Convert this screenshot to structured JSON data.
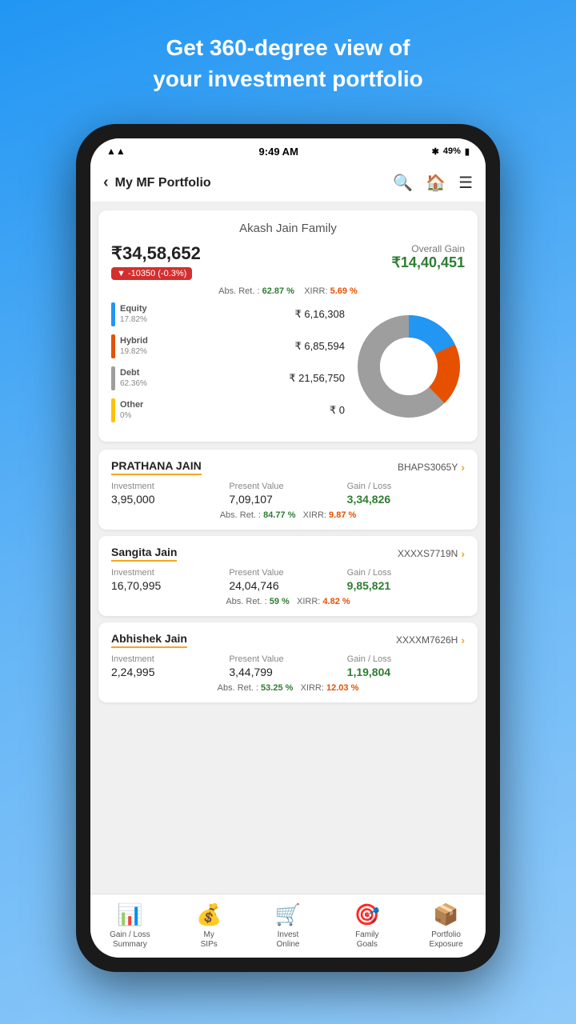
{
  "header_text": {
    "line1": "Get 360-degree view of",
    "line2": "your investment portfolio"
  },
  "status_bar": {
    "time": "9:49 AM",
    "battery": "49%",
    "bluetooth": "49%"
  },
  "page_title": "My MF Portfolio",
  "family": {
    "name": "Akash Jain Family",
    "total_value": "₹34,58,652",
    "change": "▼ -10350  (-0.3%)",
    "overall_gain_label": "Overall Gain",
    "overall_gain": "₹14,40,451",
    "abs_ret_label": "Abs. Ret. :",
    "abs_ret_value": "62.87 %",
    "xirr_label": "XIRR:",
    "xirr_value": "5.69 %"
  },
  "chart_legend": [
    {
      "name": "Equity",
      "pct": "17.82%",
      "value": "₹ 6,16,308",
      "color": "#2196F3"
    },
    {
      "name": "Hybrid",
      "pct": "19.82%",
      "value": "₹ 6,85,594",
      "color": "#e65100"
    },
    {
      "name": "Debt",
      "pct": "62.36%",
      "value": "₹ 21,56,750",
      "color": "#9e9e9e"
    },
    {
      "name": "Other",
      "pct": "0%",
      "value": "₹ 0",
      "color": "#FFC107"
    }
  ],
  "members": [
    {
      "name": "PRATHANA JAIN",
      "id": "BHAPS3065Y",
      "investment": "3,95,000",
      "present_value": "7,09,107",
      "gain_loss": "3,34,826",
      "abs_ret": "84.77 %",
      "xirr": "9.87 %"
    },
    {
      "name": "Sangita Jain",
      "id": "XXXXS7719N",
      "investment": "16,70,995",
      "present_value": "24,04,746",
      "gain_loss": "9,85,821",
      "abs_ret": "59 %",
      "xirr": "4.82 %"
    },
    {
      "name": "Abhishek Jain",
      "id": "XXXXM7626H",
      "investment": "2,24,995",
      "present_value": "3,44,799",
      "gain_loss": "1,19,804",
      "abs_ret": "53.25 %",
      "xirr": "12.03 %"
    }
  ],
  "bottom_nav": [
    {
      "id": "gain-loss",
      "label": "Gain / Loss\nSummary",
      "icon": "📊"
    },
    {
      "id": "my-sips",
      "label": "My\nSIPs",
      "icon": "💰"
    },
    {
      "id": "invest",
      "label": "Invest\nOnline",
      "icon": "🛒"
    },
    {
      "id": "family",
      "label": "Family\nGoals",
      "icon": "🎯"
    },
    {
      "id": "portfolio",
      "label": "Portfolio\nExposure",
      "icon": "📦"
    }
  ],
  "labels": {
    "investment": "Investment",
    "present_value": "Present Value",
    "gain_loss": "Gain / Loss",
    "abs_ret": "Abs. Ret. :",
    "xirr": "XIRR:"
  }
}
